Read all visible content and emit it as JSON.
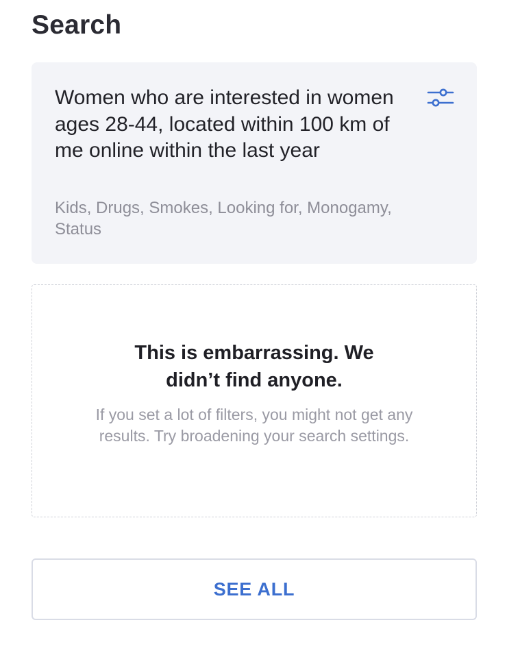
{
  "header": {
    "title": "Search"
  },
  "search_card": {
    "summary": "Women who are interested in women ages 28-44, located within 100 km of me online within the last year",
    "filters": "Kids, Drugs, Smokes, Looking for, Monogamy, Status",
    "filter_icon": "sliders-icon"
  },
  "empty_state": {
    "title": "This is embarrassing. We didn’t find anyone.",
    "description": "If you set a lot of filters, you might not get any results. Try broadening your search settings."
  },
  "actions": {
    "see_all_label": "SEE ALL"
  },
  "colors": {
    "accent": "#3c6fcf",
    "card_background": "#f3f4f8",
    "muted_text": "#8e8e98"
  }
}
